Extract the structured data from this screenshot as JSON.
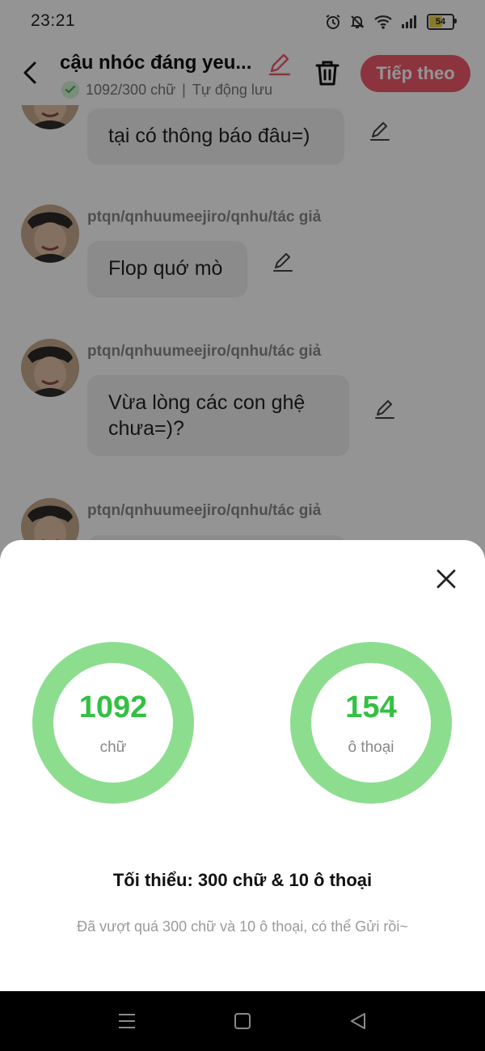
{
  "status_bar": {
    "time": "23:21",
    "battery": "54",
    "icons": [
      "alarm-icon",
      "silent-bell-icon",
      "wifi-icon",
      "signal-icon",
      "battery-icon"
    ]
  },
  "header": {
    "title": "cậu nhóc đáng yeu...",
    "word_status": "1092/300 chữ",
    "separator": "|",
    "autosave": "Tự động lưu",
    "next_button": "Tiếp theo",
    "accent_color": "#f25a6c"
  },
  "messages": [
    {
      "author": "",
      "text": "tại có thông báo đâu=)"
    },
    {
      "author": "ptqn/qnhuumeejiro/qnhu/tác giả",
      "text": "Flop quớ mò"
    },
    {
      "author": "ptqn/qnhuumeejiro/qnhu/tác giả",
      "text": "Vừa lòng các con ghệ chưa=)?"
    },
    {
      "author": "ptqn/qnhuumeejiro/qnhu/tác giả",
      "text": ""
    }
  ],
  "stats_sheet": {
    "word_count": {
      "value": "1092",
      "unit": "chữ",
      "progress": 1.0
    },
    "dialogue_count": {
      "value": "154",
      "unit": "ô thoại",
      "progress": 1.0
    },
    "requirement": "Tối thiểu: 300 chữ & 10 ô thoại",
    "note": "Đã vượt quá 300 chữ và 10 ô thoại, có thể Gửi rồi~",
    "ring_color": "#8ddd8f",
    "value_color": "#33c043"
  },
  "nav_bar": {
    "buttons": [
      "menu-icon",
      "home-icon",
      "back-triangle-icon"
    ]
  }
}
